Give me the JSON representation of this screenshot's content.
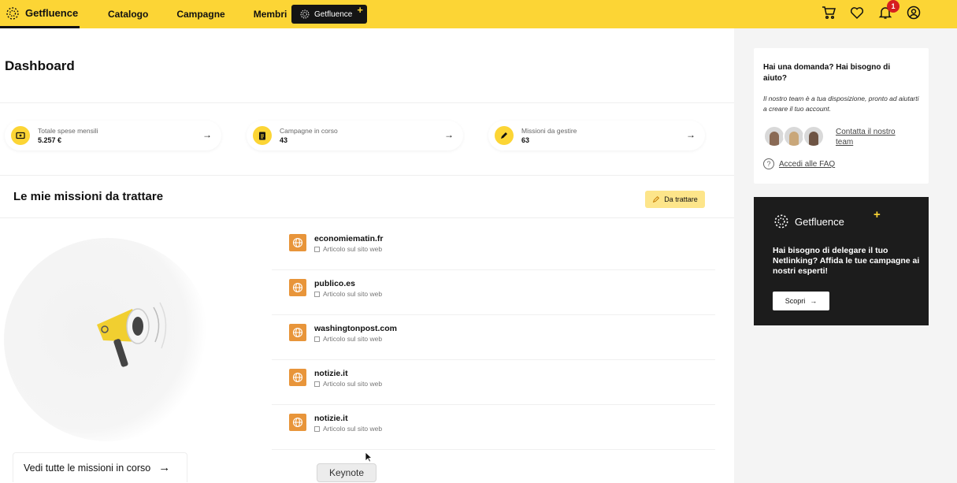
{
  "nav": {
    "brand": "Getfluence",
    "items": [
      {
        "label": "Catalogo"
      },
      {
        "label": "Campagne"
      },
      {
        "label": "Membri"
      }
    ],
    "plus_label": "Getfluence",
    "plus_symbol": "+",
    "notification_count": "1",
    "accent_color": "#fcd535"
  },
  "dashboard": {
    "title": "Dashboard",
    "stats": [
      {
        "label": "Totale spese mensili",
        "value": "5.257 €",
        "icon": "money-icon"
      },
      {
        "label": "Campagne in corso",
        "value": "43",
        "icon": "clipboard-icon"
      },
      {
        "label": "Missioni da gestire",
        "value": "63",
        "icon": "pencil-icon"
      }
    ],
    "section_title": "Le mie missioni da trattare",
    "filter_label": "Da trattare",
    "missions": [
      {
        "domain": "economiematin.fr",
        "type": "Articolo sul sito web"
      },
      {
        "domain": "publico.es",
        "type": "Articolo sul sito web"
      },
      {
        "domain": "washingtonpost.com",
        "type": "Articolo sul sito web"
      },
      {
        "domain": "notizie.it",
        "type": "Articolo sul sito web"
      },
      {
        "domain": "notizie.it",
        "type": "Articolo sul sito web"
      }
    ],
    "see_all_label": "Vedi tutte le missioni in corso"
  },
  "tooltip": "Keynote",
  "help": {
    "title": "Hai una domanda? Hai bisogno di aiuto?",
    "text": "Il nostro team è a tua disposizione, pronto ad aiutarti a creare il tuo account.",
    "contact_label": "Contatta il nostro team",
    "faq_label": "Accedi alle FAQ"
  },
  "promo": {
    "brand": "Getfluence",
    "plus": "+",
    "text": "Hai bisogno di delegare il tuo Netlinking? Affida le tue campagne ai nostri esperti!",
    "button_label": "Scopri"
  }
}
